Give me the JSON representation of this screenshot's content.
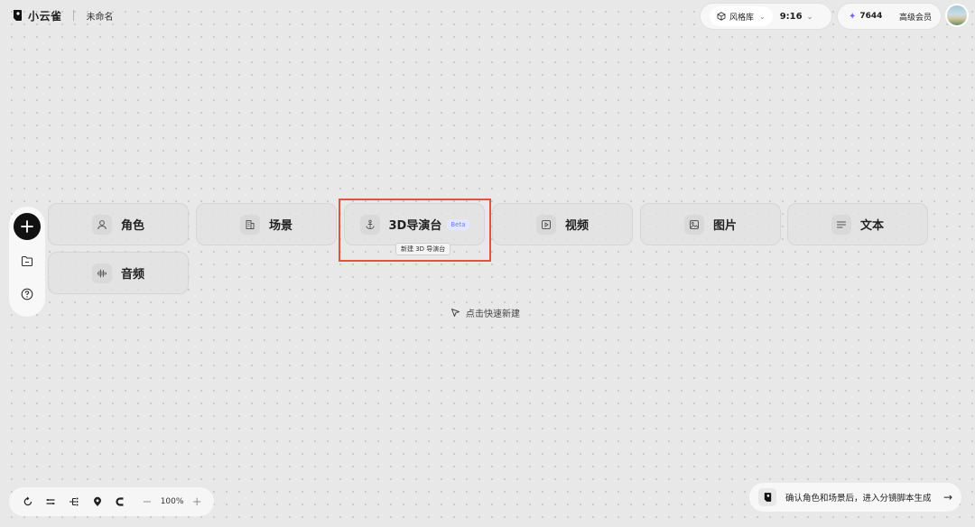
{
  "app": {
    "name": "小云雀",
    "doc_title": "未命名"
  },
  "header": {
    "style_library": "风格库",
    "aspect_ratio": "9:16",
    "credits": "7644",
    "membership": "高级会员"
  },
  "cards": [
    {
      "label": "角色",
      "icon": "person-icon"
    },
    {
      "label": "场景",
      "icon": "building-icon"
    },
    {
      "label": "3D导演台",
      "icon": "anchor-icon",
      "badge": "Beta",
      "tooltip": "新建 3D 导演台"
    },
    {
      "label": "视频",
      "icon": "video-play-icon"
    },
    {
      "label": "图片",
      "icon": "image-icon"
    },
    {
      "label": "文本",
      "icon": "text-lines-icon"
    },
    {
      "label": "音频",
      "icon": "waveform-icon"
    }
  ],
  "canvas_hint": "点击快速新建",
  "bottom_toolbar": {
    "zoom": "100%",
    "minus": "−",
    "plus": "+"
  },
  "next_action": {
    "label": "确认角色和场景后，进入分镜脚本生成",
    "arrow": "→"
  },
  "colors": {
    "highlight": "#e0533c",
    "star": "#7b61ff",
    "beta": "#6b7cff"
  }
}
